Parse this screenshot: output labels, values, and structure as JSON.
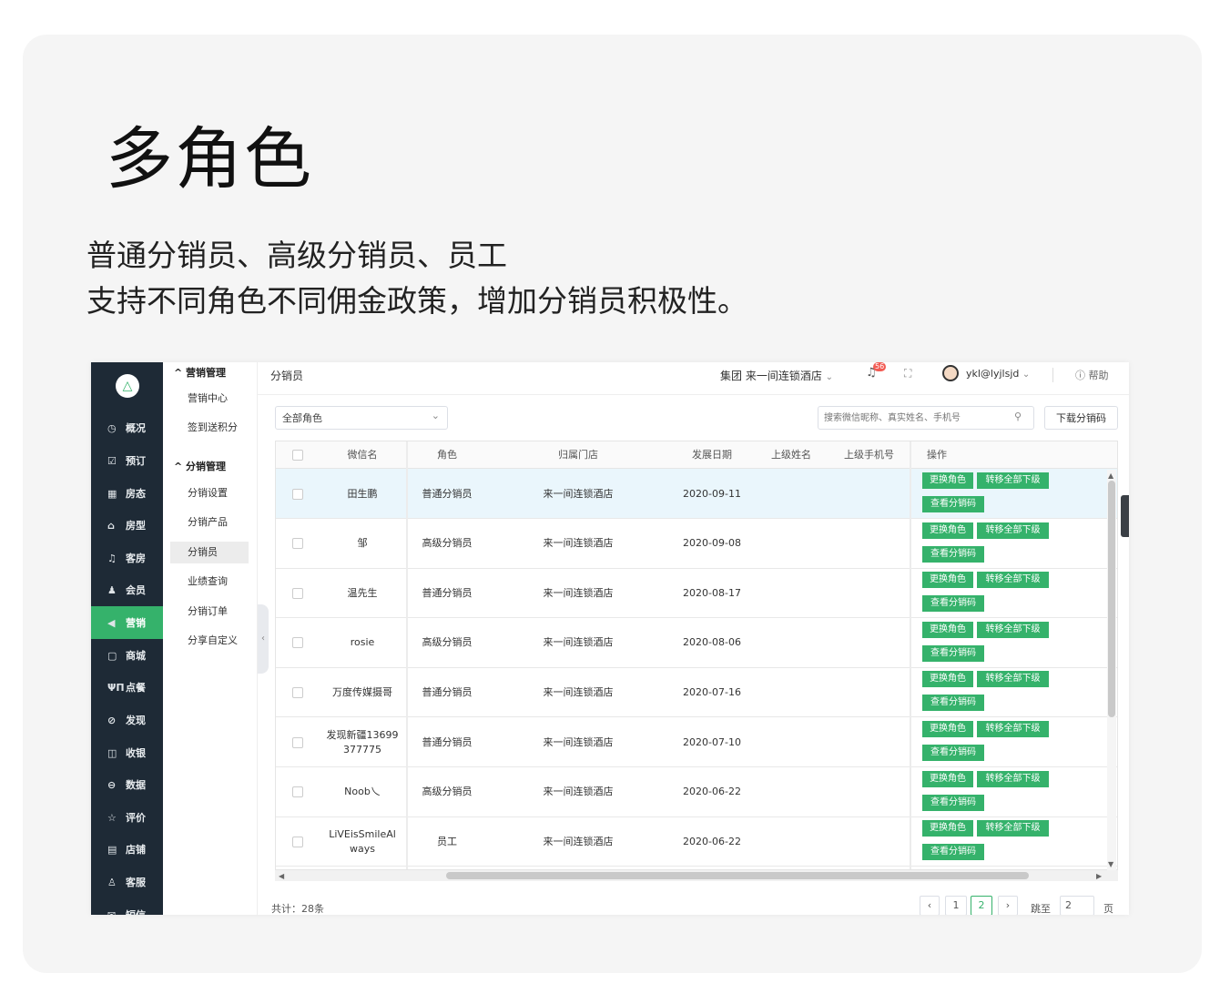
{
  "hero": {
    "title": "多角色",
    "subtitle_line1": "普通分销员、高级分销员、员工",
    "subtitle_line2": "支持不同角色不同佣金政策，增加分销员积极性。"
  },
  "nav": {
    "logo": "△",
    "items": [
      {
        "label": "概况",
        "icon": "◷"
      },
      {
        "label": "预订",
        "icon": "☑"
      },
      {
        "label": "房态",
        "icon": "▦"
      },
      {
        "label": "房型",
        "icon": "⌂"
      },
      {
        "label": "客房",
        "icon": "♫"
      },
      {
        "label": "会员",
        "icon": "♟"
      },
      {
        "label": "营销",
        "icon": "◀"
      },
      {
        "label": "商城",
        "icon": "▢"
      },
      {
        "label": "点餐",
        "icon": "ΨΠ"
      },
      {
        "label": "发现",
        "icon": "⊘"
      },
      {
        "label": "收银",
        "icon": "◫"
      },
      {
        "label": "数据",
        "icon": "⊖"
      },
      {
        "label": "评价",
        "icon": "☆"
      },
      {
        "label": "店铺",
        "icon": "▤"
      },
      {
        "label": "客服",
        "icon": "♙"
      },
      {
        "label": "短信",
        "icon": "✉"
      }
    ]
  },
  "subnav": {
    "group1": "营销管理",
    "group1_items": [
      "营销中心",
      "签到送积分"
    ],
    "group2": "分销管理",
    "group2_items": [
      "分销设置",
      "分销产品",
      "分销员",
      "业绩查询",
      "分销订单",
      "分享自定义"
    ]
  },
  "topbar": {
    "title": "分销员",
    "store": "集团 来一间连锁酒店",
    "badge": "56",
    "user": "ykl@lyjlsjd",
    "help": "帮助"
  },
  "filter": {
    "role_select": "全部角色",
    "search_placeholder": "搜索微信昵称、真实姓名、手机号",
    "download_label": "下载分销码"
  },
  "table": {
    "headers": [
      "微信名",
      "角色",
      "归属门店",
      "发展日期",
      "上级姓名",
      "上级手机号",
      "操作"
    ],
    "actions": {
      "change_role": "更换角色",
      "transfer": "转移全部下级",
      "view_code": "查看分销码"
    },
    "rows": [
      {
        "name": "田生鹏",
        "role": "普通分销员",
        "store": "来一间连锁酒店",
        "date": "2020-09-11"
      },
      {
        "name": "邹",
        "role": "高级分销员",
        "store": "来一间连锁酒店",
        "date": "2020-09-08"
      },
      {
        "name": "温先生",
        "role": "普通分销员",
        "store": "来一间连锁酒店",
        "date": "2020-08-17"
      },
      {
        "name": "rosie",
        "role": "高级分销员",
        "store": "来一间连锁酒店",
        "date": "2020-08-06"
      },
      {
        "name": "万度传媒摄哥",
        "role": "普通分销员",
        "store": "来一间连锁酒店",
        "date": "2020-07-16"
      },
      {
        "name": "发现新疆13699\n377775",
        "role": "普通分销员",
        "store": "来一间连锁酒店",
        "date": "2020-07-10"
      },
      {
        "name": "Noob乀",
        "role": "高级分销员",
        "store": "来一间连锁酒店",
        "date": "2020-06-22"
      },
      {
        "name": "LiVEisSmileAl\nways",
        "role": "员工",
        "store": "来一间连锁酒店",
        "date": "2020-06-22"
      }
    ]
  },
  "footer": {
    "total": "共计：28条",
    "pages": [
      "1",
      "2"
    ],
    "current_page": "2",
    "jump_label": "跳至",
    "jump_value": "2",
    "page_unit": "页"
  }
}
